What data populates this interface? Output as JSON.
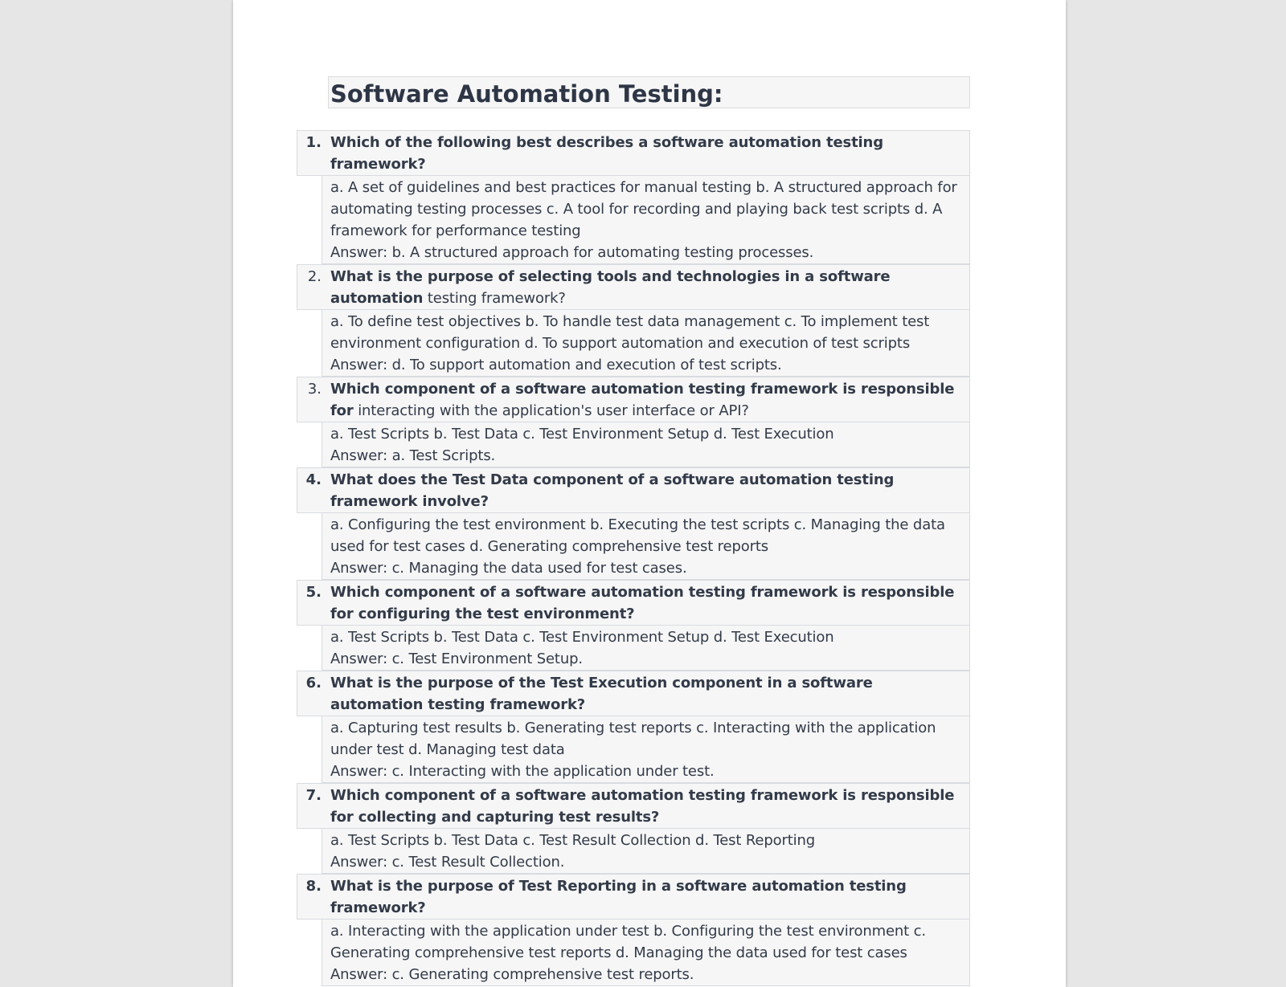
{
  "document": {
    "title": "Software Automation Testing:",
    "questions": [
      {
        "number": "1.",
        "bold_part": "Which of the following best describes a software automation testing framework?",
        "rest": "",
        "options": "a. A set of guidelines and best practices for manual testing b. A structured approach for automating testing processes c. A tool for recording and playing back test scripts d. A framework for performance testing",
        "answer": "Answer: b. A structured approach for automating testing processes."
      },
      {
        "number": "2.",
        "bold_part": "What is the purpose of selecting tools and technologies in a software automation",
        "rest": "testing framework?",
        "options": " a. To define test objectives b. To handle test data management c. To implement test environment configuration d. To support automation and execution of test scripts",
        "answer": "Answer: d. To support automation and execution of test scripts."
      },
      {
        "number": "3.",
        "bold_part": "Which component of a software automation testing framework is responsible for",
        "rest": "interacting with the application's user interface or API?",
        "options": " a. Test Scripts b. Test Data c. Test Environment Setup d. Test Execution",
        "answer": "Answer: a. Test Scripts."
      },
      {
        "number": "4.",
        "bold_part": "What does the Test Data component of a software automation testing framework involve?",
        "rest": "",
        "options": " a. Configuring the test environment b. Executing the test scripts c. Managing the data used for test cases d. Generating comprehensive test reports",
        "answer": "Answer: c. Managing the data used for test cases."
      },
      {
        "number": "5.",
        "bold_part": "Which component of a software automation testing framework is responsible for configuring the test environment?",
        "rest": "",
        "options": " a. Test Scripts b. Test Data c. Test Environment Setup d. Test Execution",
        "answer": "Answer: c. Test Environment Setup."
      },
      {
        "number": "6.",
        "bold_part": "What is the purpose of the Test Execution component in a software automation testing framework?",
        "rest": "",
        "options": "a. Capturing test results b. Generating test reports c. Interacting with the application under test d. Managing test data",
        "answer": "Answer: c. Interacting with the application under test."
      },
      {
        "number": "7.",
        "bold_part": "Which component of a software automation testing framework is responsible for collecting and capturing test results?",
        "rest": "",
        "options": " a. Test Scripts b. Test Data c. Test Result Collection d. Test Reporting",
        "answer": "Answer: c. Test Result Collection."
      },
      {
        "number": "8.",
        "bold_part": "What is the purpose of Test Reporting in a software automation testing framework?",
        "rest": "",
        "options": "a. Interacting with the application under test b. Configuring the test environment c. Generating comprehensive test reports d. Managing the data used for test cases",
        "answer": "Answer: c. Generating comprehensive test reports."
      }
    ]
  }
}
